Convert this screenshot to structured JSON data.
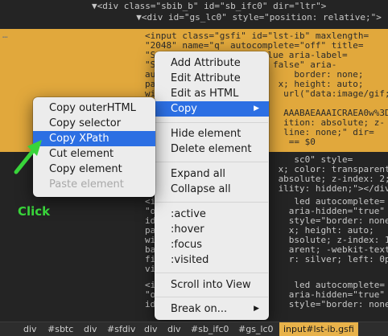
{
  "code_lines": [
    {
      "text": "▼<div class=\"sbib_b\" id=\"sb_ifc0\" dir=\"ltr\">"
    },
    {
      "text": "  ▼<div id=\"gs_lc0\" style=\"position: relative;\">"
    },
    {
      "text": "<input class=\"gsfi\" id=\"lst-ib\" maxlength="
    },
    {
      "text": "\"2048\" name=\"q\" autocomplete=\"off\" title="
    },
    {
      "text": "\"Search\" type=\"text\" value aria-label="
    },
    {
      "text": "\"S                      false\" aria-"
    },
    {
      "text": "au                          border: none;"
    },
    {
      "text": "pa                       x; height: auto;"
    },
    {
      "text": "wi                        url(\"data:image/gif;"
    },
    {
      "text": "ba"
    },
    {
      "text": "R0                        AAABAEAAAICRAEA0w%3D"
    },
    {
      "text": "%3                        ition: absolute; z-"
    },
    {
      "text": "in                        line: none;\" dir="
    },
    {
      "text": "\"l                         == $0"
    },
    {
      "text": "<d                          sc0\" style="
    },
    {
      "text": "\"c                       x; color: transparent;"
    },
    {
      "text": "po                       absolute; z-index: 2;"
    },
    {
      "text": "wh                       ility: hidden;\"></div>"
    },
    {
      "text": "<i                          led autocomplete="
    },
    {
      "text": "\"o                         aria-hidden=\"true\""
    },
    {
      "text": "id                         style=\"border: none;"
    },
    {
      "text": "pa                         x; height: auto;"
    },
    {
      "text": "wi                         bsolute; z-index: 1;"
    },
    {
      "text": "ba                         arent; -webkit-text-"
    },
    {
      "text": "fi                         r: silver; left: 0px;"
    },
    {
      "text": "vi"
    },
    {
      "text": "<i                          led autocomplete="
    },
    {
      "text": "\"o                         aria-hidden=\"true\""
    },
    {
      "text": "id                         style=\"border: none;"
    }
  ],
  "context_menu": {
    "items": [
      {
        "label": "Add Attribute"
      },
      {
        "label": "Edit Attribute"
      },
      {
        "label": "Edit as HTML"
      },
      {
        "label": "Copy",
        "submenu": true
      },
      {
        "separator": true
      },
      {
        "label": "Hide element"
      },
      {
        "label": "Delete element"
      },
      {
        "separator": true
      },
      {
        "label": "Expand all"
      },
      {
        "label": "Collapse all"
      },
      {
        "separator": true
      },
      {
        "label": ":active"
      },
      {
        "label": ":hover"
      },
      {
        "label": ":focus"
      },
      {
        "label": ":visited"
      },
      {
        "separator": true
      },
      {
        "label": "Scroll into View"
      },
      {
        "separator": true
      },
      {
        "label": "Break on...",
        "submenu": true
      }
    ]
  },
  "copy_submenu": {
    "items": [
      {
        "label": "Copy outerHTML"
      },
      {
        "label": "Copy selector"
      },
      {
        "label": "Copy XPath",
        "highlighted": true
      },
      {
        "label": "Cut element"
      },
      {
        "label": "Copy element"
      },
      {
        "label": "Paste element",
        "disabled": true
      }
    ]
  },
  "annotation": {
    "click_label": "Click",
    "color": "#38d43a"
  },
  "breadcrumb": {
    "items": [
      "div",
      "#sbtc",
      "div",
      "#sfdiv",
      "div",
      "div",
      "#sb_ifc0",
      "#gs_lc0",
      "input#lst-ib.gsfi"
    ],
    "selected_index": 8
  },
  "colors": {
    "highlight_band": "#e1a83c",
    "menu_selection": "#2c6fe3",
    "background": "#242424"
  }
}
